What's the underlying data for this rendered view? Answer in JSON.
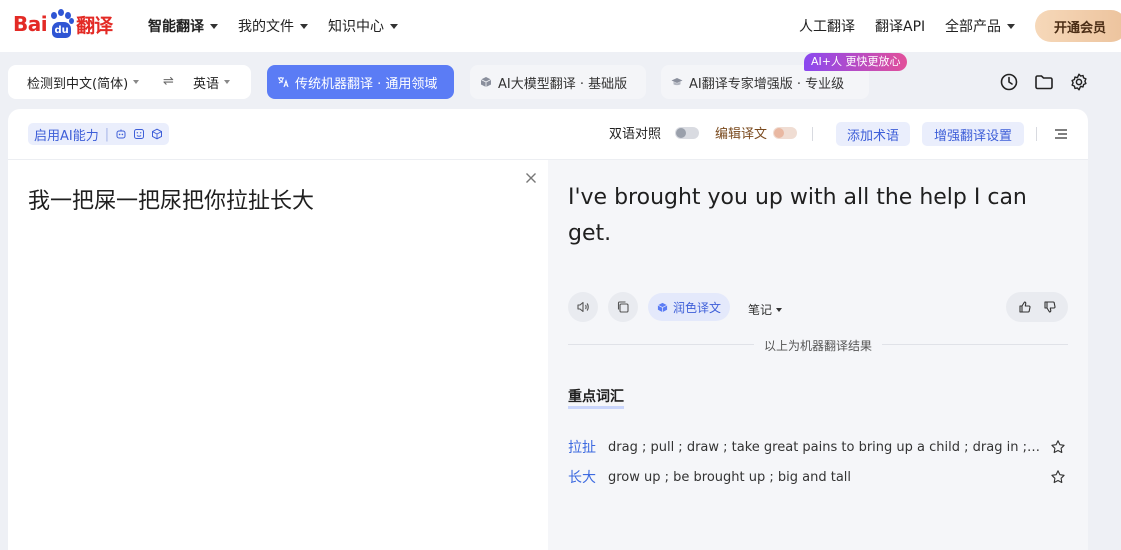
{
  "logo": {
    "text_bai": "Bai",
    "text_du": "du",
    "text_fy": "翻译"
  },
  "nav": {
    "items": [
      {
        "label": "智能翻译",
        "has_caret": true
      },
      {
        "label": "我的文件",
        "has_caret": true
      },
      {
        "label": "知识中心",
        "has_caret": true
      }
    ],
    "right_items": [
      {
        "label": "人工翻译"
      },
      {
        "label": "翻译API"
      },
      {
        "label": "全部产品",
        "has_caret": true
      }
    ],
    "vip_label": "开通会员"
  },
  "lang": {
    "source": "检测到中文(简体)",
    "swap_icon": "⇌",
    "target": "英语"
  },
  "modes": [
    {
      "label": "传统机器翻译 · 通用领域",
      "active": true,
      "icon": "translate-icon"
    },
    {
      "label": "AI大模型翻译 · 基础版",
      "active": false,
      "icon": "cube-icon"
    },
    {
      "label": "AI翻译专家增强版 · 专业级",
      "active": false,
      "icon": "graduation-cap-icon"
    }
  ],
  "ai_tag": "AI+人 更快更放心",
  "toolbar_icons": [
    "history-icon",
    "folder-icon",
    "settings-icon"
  ],
  "card_head": {
    "ai_ability_label": "启用AI能力",
    "ai_ability_icons": [
      "ai-robot-icon",
      "ai-face-icon",
      "ai-cube-icon"
    ],
    "bilingual_label": "双语对照",
    "edit_label": "编辑译文",
    "add_term_label": "添加术语",
    "enhance_label": "增强翻译设置",
    "menu_icon": "list-menu-icon"
  },
  "source_text": "我一把屎一把尿把你拉扯长大",
  "translation": {
    "text": "I've brought you up with all the help I can get.",
    "polish_label": "润色译文",
    "notes_label": "笔记",
    "mt_note": "以上为机器翻译结果"
  },
  "vocab": {
    "title": "重点词汇",
    "items": [
      {
        "word": "拉扯",
        "def": "drag ; pull ; draw ; take great pains to bring up a child ; drag in ; chat"
      },
      {
        "word": "长大",
        "def": "grow up ; be brought up ; big and tall"
      }
    ]
  },
  "colors": {
    "brand_red": "#e32a25",
    "brand_blue": "#2f55d4",
    "accent": "#5b7cf5",
    "link": "#3d6ae0"
  }
}
